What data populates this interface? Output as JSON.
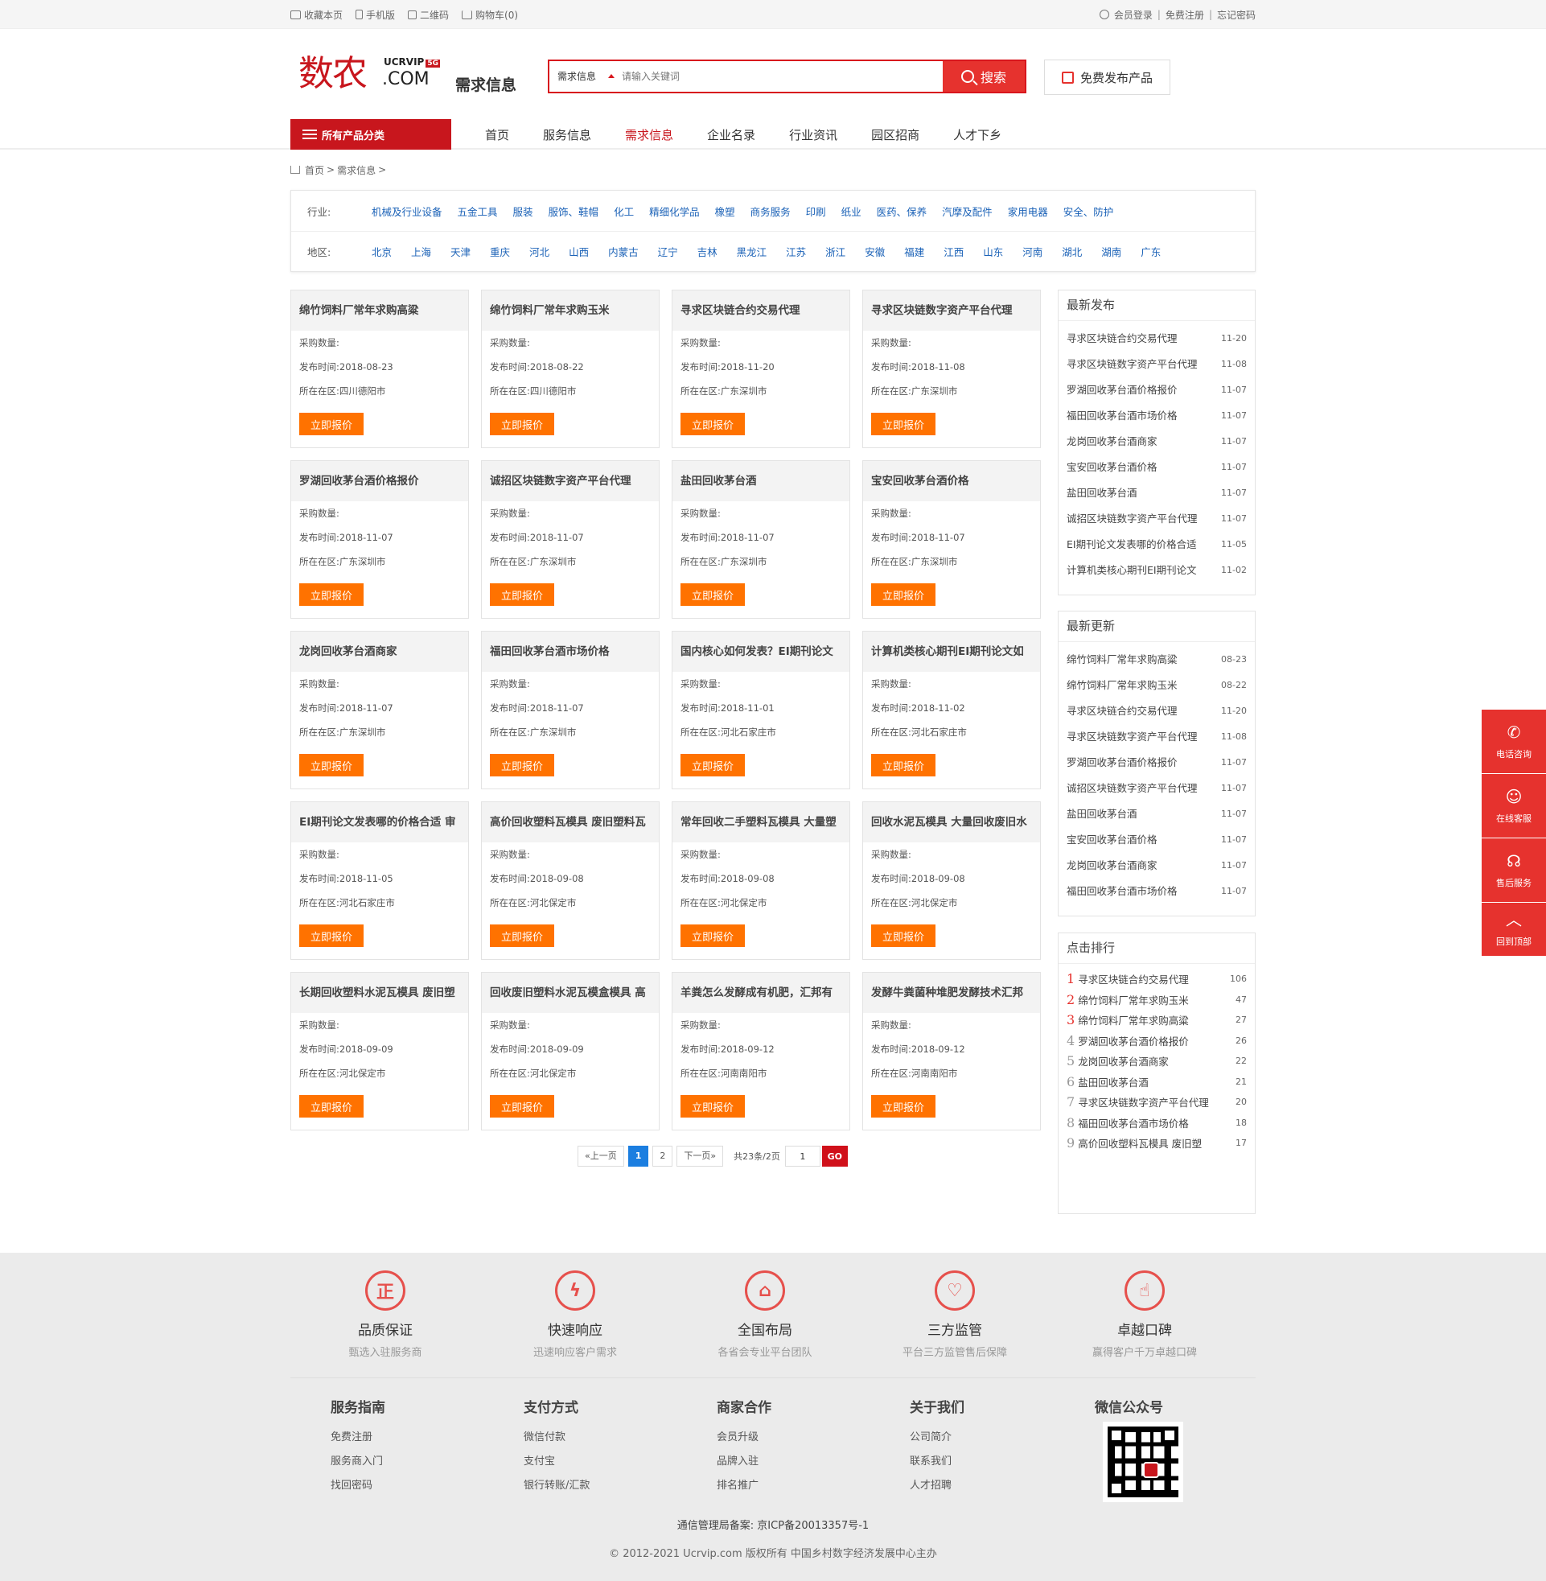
{
  "topbar": {
    "left": [
      "收藏本页",
      "手机版",
      "二维码",
      "购物车(0)"
    ],
    "right": [
      "会员登录",
      "免费注册",
      "忘记密码"
    ],
    "sep": "|"
  },
  "header": {
    "logo_big": "数农",
    "logo_uc": "UCRVIP",
    "logo_badge": "5G",
    "logo_com": ".COM",
    "page_tag": "需求信息",
    "search_select": "需求信息",
    "search_placeholder": "请输入关键词",
    "search_button": "搜索",
    "free_publish": "免费发布产品"
  },
  "nav": {
    "all_categories": "所有产品分类",
    "items": [
      "首页",
      "服务信息",
      "需求信息",
      "企业名录",
      "行业资讯",
      "园区招商",
      "人才下乡"
    ],
    "active": "需求信息"
  },
  "breadcrumb": {
    "home": "首页",
    "sep": ">",
    "current": "需求信息"
  },
  "filter": {
    "industry_label": "行业:",
    "industries": [
      "机械及行业设备",
      "五金工具",
      "服装",
      "服饰、鞋帽",
      "化工",
      "精细化学品",
      "橡塑",
      "商务服务",
      "印刷",
      "纸业",
      "医药、保养",
      "汽摩及配件",
      "家用电器",
      "安全、防护"
    ],
    "region_label": "地区:",
    "regions": [
      "北京",
      "上海",
      "天津",
      "重庆",
      "河北",
      "山西",
      "内蒙古",
      "辽宁",
      "吉林",
      "黑龙江",
      "江苏",
      "浙江",
      "安徽",
      "福建",
      "江西",
      "山东",
      "河南",
      "湖北",
      "湖南",
      "广东"
    ]
  },
  "card_labels": {
    "qty": "采购数量:",
    "time": "发布时间:",
    "loc": "所在在区:",
    "quote": "立即报价"
  },
  "cards": [
    {
      "title": "绵竹饲料厂常年求购高粱",
      "time": "2018-08-23",
      "loc": "四川德阳市"
    },
    {
      "title": "绵竹饲料厂常年求购玉米",
      "time": "2018-08-22",
      "loc": "四川德阳市"
    },
    {
      "title": "寻求区块链合约交易代理",
      "time": "2018-11-20",
      "loc": "广东深圳市"
    },
    {
      "title": "寻求区块链数字资产平台代理",
      "time": "2018-11-08",
      "loc": "广东深圳市"
    },
    {
      "title": "罗湖回收茅台酒价格报价",
      "time": "2018-11-07",
      "loc": "广东深圳市"
    },
    {
      "title": "诚招区块链数字资产平台代理",
      "time": "2018-11-07",
      "loc": "广东深圳市"
    },
    {
      "title": "盐田回收茅台酒",
      "time": "2018-11-07",
      "loc": "广东深圳市"
    },
    {
      "title": "宝安回收茅台酒价格",
      "time": "2018-11-07",
      "loc": "广东深圳市"
    },
    {
      "title": "龙岗回收茅台酒商家",
      "time": "2018-11-07",
      "loc": "广东深圳市"
    },
    {
      "title": "福田回收茅台酒市场价格",
      "time": "2018-11-07",
      "loc": "广东深圳市"
    },
    {
      "title": "国内核心如何发表？EI期刊论文",
      "time": "2018-11-01",
      "loc": "河北石家庄市"
    },
    {
      "title": "计算机类核心期刊EI期刊论文如",
      "time": "2018-11-02",
      "loc": "河北石家庄市"
    },
    {
      "title": "EI期刊论文发表哪的价格合适 审",
      "time": "2018-11-05",
      "loc": "河北石家庄市"
    },
    {
      "title": "高价回收塑料瓦模具 废旧塑料瓦",
      "time": "2018-09-08",
      "loc": "河北保定市"
    },
    {
      "title": "常年回收二手塑料瓦模具 大量塑",
      "time": "2018-09-08",
      "loc": "河北保定市"
    },
    {
      "title": "回收水泥瓦模具 大量回收废旧水",
      "time": "2018-09-08",
      "loc": "河北保定市"
    },
    {
      "title": "长期回收塑料水泥瓦模具 废旧塑",
      "time": "2018-09-09",
      "loc": "河北保定市"
    },
    {
      "title": "回收废旧塑料水泥瓦模盒模具 高",
      "time": "2018-09-09",
      "loc": "河北保定市"
    },
    {
      "title": "羊粪怎么发酵成有机肥，汇邦有",
      "time": "2018-09-12",
      "loc": "河南南阳市"
    },
    {
      "title": "发酵牛粪菌种堆肥发酵技术汇邦",
      "time": "2018-09-12",
      "loc": "河南南阳市"
    }
  ],
  "pager": {
    "prev": "«上一页",
    "pages": [
      "1",
      "2"
    ],
    "current": "1",
    "next": "下一页»",
    "total": "共23条/2页",
    "input_value": "1",
    "go": "GO"
  },
  "sidebar": {
    "latest": {
      "title": "最新发布",
      "items": [
        {
          "t": "寻求区块链合约交易代理",
          "d": "11-20"
        },
        {
          "t": "寻求区块链数字资产平台代理",
          "d": "11-08"
        },
        {
          "t": "罗湖回收茅台酒价格报价",
          "d": "11-07"
        },
        {
          "t": "福田回收茅台酒市场价格",
          "d": "11-07"
        },
        {
          "t": "龙岗回收茅台酒商家",
          "d": "11-07"
        },
        {
          "t": "宝安回收茅台酒价格",
          "d": "11-07"
        },
        {
          "t": "盐田回收茅台酒",
          "d": "11-07"
        },
        {
          "t": "诚招区块链数字资产平台代理",
          "d": "11-07"
        },
        {
          "t": "EI期刊论文发表哪的价格合适",
          "d": "11-05"
        },
        {
          "t": "计算机类核心期刊EI期刊论文",
          "d": "11-02"
        }
      ]
    },
    "updated": {
      "title": "最新更新",
      "items": [
        {
          "t": "绵竹饲料厂常年求购高粱",
          "d": "08-23"
        },
        {
          "t": "绵竹饲料厂常年求购玉米",
          "d": "08-22"
        },
        {
          "t": "寻求区块链合约交易代理",
          "d": "11-20"
        },
        {
          "t": "寻求区块链数字资产平台代理",
          "d": "11-08"
        },
        {
          "t": "罗湖回收茅台酒价格报价",
          "d": "11-07"
        },
        {
          "t": "诚招区块链数字资产平台代理",
          "d": "11-07"
        },
        {
          "t": "盐田回收茅台酒",
          "d": "11-07"
        },
        {
          "t": "宝安回收茅台酒价格",
          "d": "11-07"
        },
        {
          "t": "龙岗回收茅台酒商家",
          "d": "11-07"
        },
        {
          "t": "福田回收茅台酒市场价格",
          "d": "11-07"
        }
      ]
    },
    "ranking": {
      "title": "点击排行",
      "items": [
        {
          "r": "1",
          "t": "寻求区块链合约交易代理",
          "d": "106"
        },
        {
          "r": "2",
          "t": "绵竹饲料厂常年求购玉米",
          "d": "47"
        },
        {
          "r": "3",
          "t": "绵竹饲料厂常年求购高粱",
          "d": "27"
        },
        {
          "r": "4",
          "t": "罗湖回收茅台酒价格报价",
          "d": "26"
        },
        {
          "r": "5",
          "t": "龙岗回收茅台酒商家",
          "d": "22"
        },
        {
          "r": "6",
          "t": "盐田回收茅台酒",
          "d": "21"
        },
        {
          "r": "7",
          "t": "寻求区块链数字资产平台代理",
          "d": "20"
        },
        {
          "r": "8",
          "t": "福田回收茅台酒市场价格",
          "d": "18"
        },
        {
          "r": "9",
          "t": "高价回收塑料瓦模具 废旧塑",
          "d": "17"
        }
      ]
    }
  },
  "features": [
    {
      "icon": "正",
      "name": "品质保证",
      "desc": "甄选入驻服务商"
    },
    {
      "icon": "ϟ",
      "name": "快速响应",
      "desc": "迅速响应客户需求"
    },
    {
      "icon": "⌂",
      "name": "全国布局",
      "desc": "各省会专业平台团队"
    },
    {
      "icon": "♡",
      "name": "三方监管",
      "desc": "平台三方监管售后保障"
    },
    {
      "icon": "☝",
      "name": "卓越口碑",
      "desc": "赢得客户千万卓越口碑"
    }
  ],
  "footer_cols": [
    {
      "title": "服务指南",
      "links": [
        "免费注册",
        "服务商入门",
        "找回密码"
      ]
    },
    {
      "title": "支付方式",
      "links": [
        "微信付款",
        "支付宝",
        "银行转账/汇款"
      ]
    },
    {
      "title": "商家合作",
      "links": [
        "会员升级",
        "品牌入驻",
        "排名推广"
      ]
    },
    {
      "title": "关于我们",
      "links": [
        "公司简介",
        "联系我们",
        "人才招聘"
      ]
    }
  ],
  "wechat_title": "微信公众号",
  "beian": "通信管理局备案:    京ICP备20013357号-1",
  "copyright": "© 2012-2021 Ucrvip.com 版权所有 中国乡村数字经济发展中心主办",
  "float_bar": [
    "电话咨询",
    "在线客服",
    "售后服务",
    "回到顶部"
  ],
  "colors": {
    "brand": "#c8161d",
    "accent": "#e6322e",
    "quote": "#ff7200",
    "link": "#1b62b7"
  }
}
